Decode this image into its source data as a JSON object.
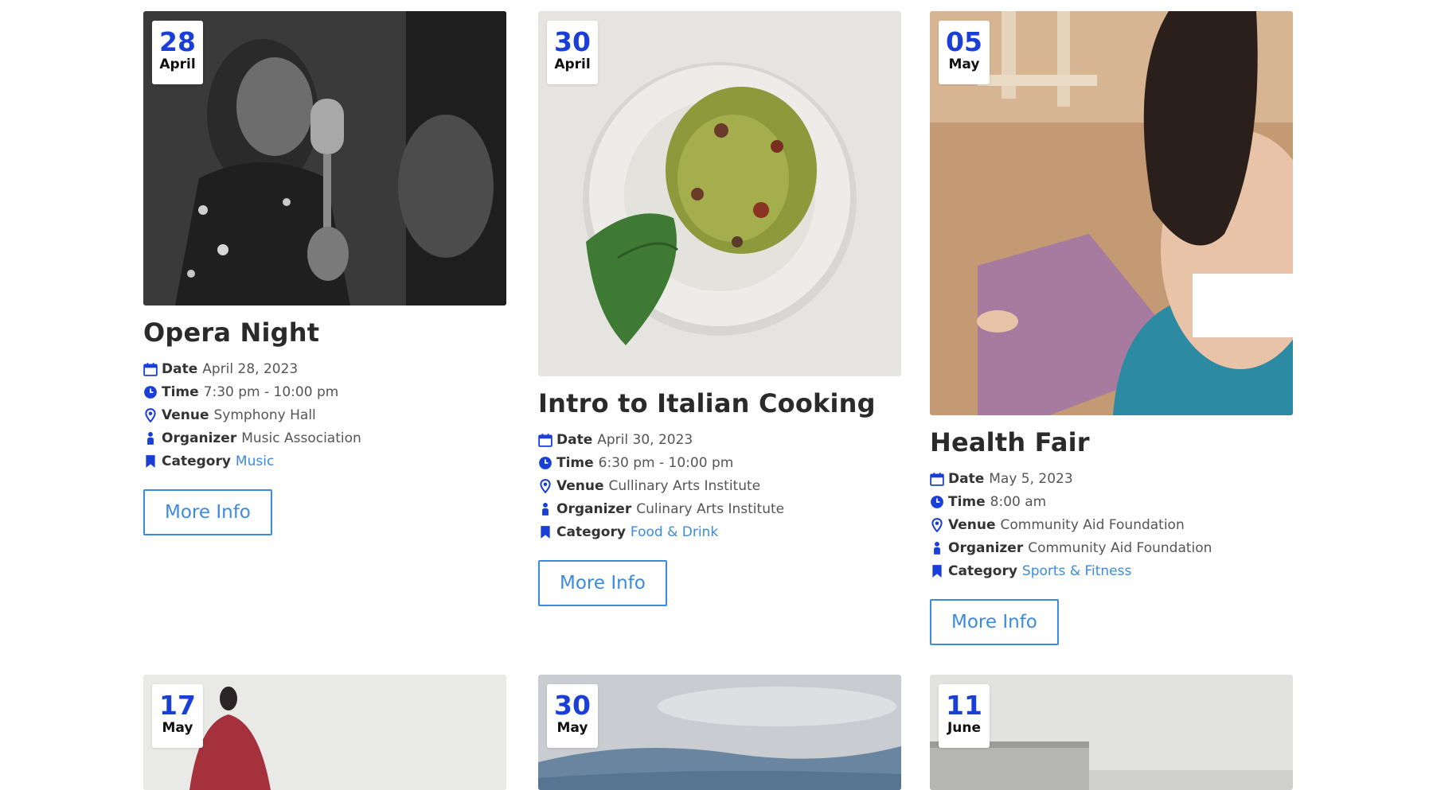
{
  "labels": {
    "date": "Date",
    "time": "Time",
    "venue": "Venue",
    "organizer": "Organizer",
    "category": "Category"
  },
  "events": [
    {
      "day": "28",
      "month": "April",
      "title": "Opera Night",
      "date": "April 28, 2023",
      "time": "7:30 pm - 10:00 pm",
      "venue": "Symphony Hall",
      "organizer": "Music Association",
      "category": "Music",
      "button": "More Info",
      "image": "black-and-white-singer-with-microphone"
    },
    {
      "day": "30",
      "month": "April",
      "title": "Intro to Italian Cooking",
      "date": "April 30, 2023",
      "time": "6:30 pm - 10:00 pm",
      "venue": "Cullinary Arts Institute",
      "organizer": "Culinary Arts Institute",
      "category": "Food & Drink",
      "button": "More Info",
      "image": "pesto-pasta-plate-with-basil"
    },
    {
      "day": "05",
      "month": "May",
      "title": "Health Fair",
      "date": "May 5, 2023",
      "time": "8:00 am",
      "venue": "Community Aid Foundation",
      "organizer": "Community Aid Foundation",
      "category": "Sports & Fitness",
      "button": "More Info",
      "image": "woman-meditating-on-yoga-mat"
    },
    {
      "day": "17",
      "month": "May",
      "image": "person-in-red-shirt"
    },
    {
      "day": "30",
      "month": "May",
      "image": "sky-with-clouds"
    },
    {
      "day": "11",
      "month": "June",
      "image": "grey-interior-shelves"
    }
  ],
  "colors": {
    "accent": "#1a3fd6",
    "link": "#3a8be0",
    "title": "#2a2a2a"
  }
}
